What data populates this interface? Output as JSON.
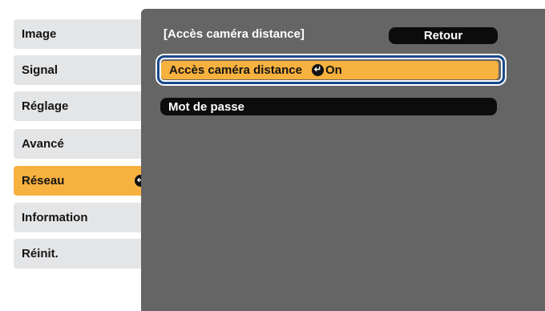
{
  "menu": {
    "items": [
      {
        "label": "Image"
      },
      {
        "label": "Signal"
      },
      {
        "label": "Réglage"
      },
      {
        "label": "Avancé"
      },
      {
        "label": "Réseau"
      },
      {
        "label": "Information"
      },
      {
        "label": "Réinit."
      }
    ],
    "active_index": 4
  },
  "panel": {
    "title": "[Accès caméra distance]",
    "back_label": "Retour",
    "options": [
      {
        "label": "Accès caméra distance",
        "value": "On",
        "selected": true
      },
      {
        "label": "Mot de passe",
        "selected": false
      }
    ]
  },
  "colors": {
    "menu_bg": "#e4e5e7",
    "highlight": "#f7b13e",
    "panel_bg": "#656565",
    "frame": "#1b4a8c"
  },
  "icons": {
    "enter": "enter-icon"
  }
}
